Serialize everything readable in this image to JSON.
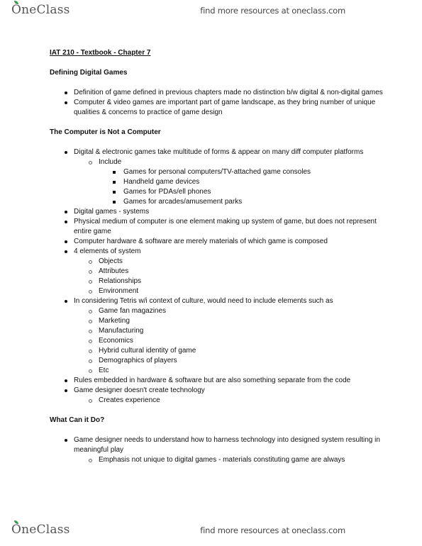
{
  "header": {
    "logo_text": "OneClass",
    "tagline": "find more resources at oneclass.com"
  },
  "footer": {
    "logo_text": "OneClass",
    "tagline": "find more resources at oneclass.com"
  },
  "document": {
    "title": "IAT 210 - Textbook - Chapter 7",
    "sections": [
      {
        "heading": "Defining Digital Games",
        "items": [
          "Definition of game defined in previous chapters made no distinction b/w digital & non-digital games",
          "Computer & video games are important part of game landscape, as they bring number of unique qualities & concerns to practice of game design"
        ]
      },
      {
        "heading": "The Computer is Not a Computer",
        "items": [
          "Digital & electronic games take multitude of forms & appear on many diff computer platforms",
          "Include",
          "Games for personal computers/TV-attached game consoles",
          "Handheld game devices",
          "Games for PDAs/ell phones",
          "Games for arcades/amusement parks",
          "Digital games - systems",
          "Physical medium of computer is one element making up system of game, but does not represent entire game",
          "Computer hardware & software are merely materials of which game is composed",
          "4 elements of system",
          "Objects",
          "Attributes",
          "Relationships",
          "Environment",
          "In considering Tetris w/i context of culture, would need to include elements such as",
          "Game fan magazines",
          "Marketing",
          "Manufacturing",
          "Economics",
          "Hybrid cultural identity of game",
          "Demographics of players",
          "Etc",
          "Rules embedded in hardware & software but are also something separate from the code",
          "Game designer doesn't create technology",
          "Creates experience"
        ]
      },
      {
        "heading": "What Can it Do?",
        "items": [
          "Game designer needs to understand how to harness technology into designed system resulting in meaningful play",
          "Emphasis not unique to digital games - materials constituting game are always"
        ]
      }
    ]
  }
}
